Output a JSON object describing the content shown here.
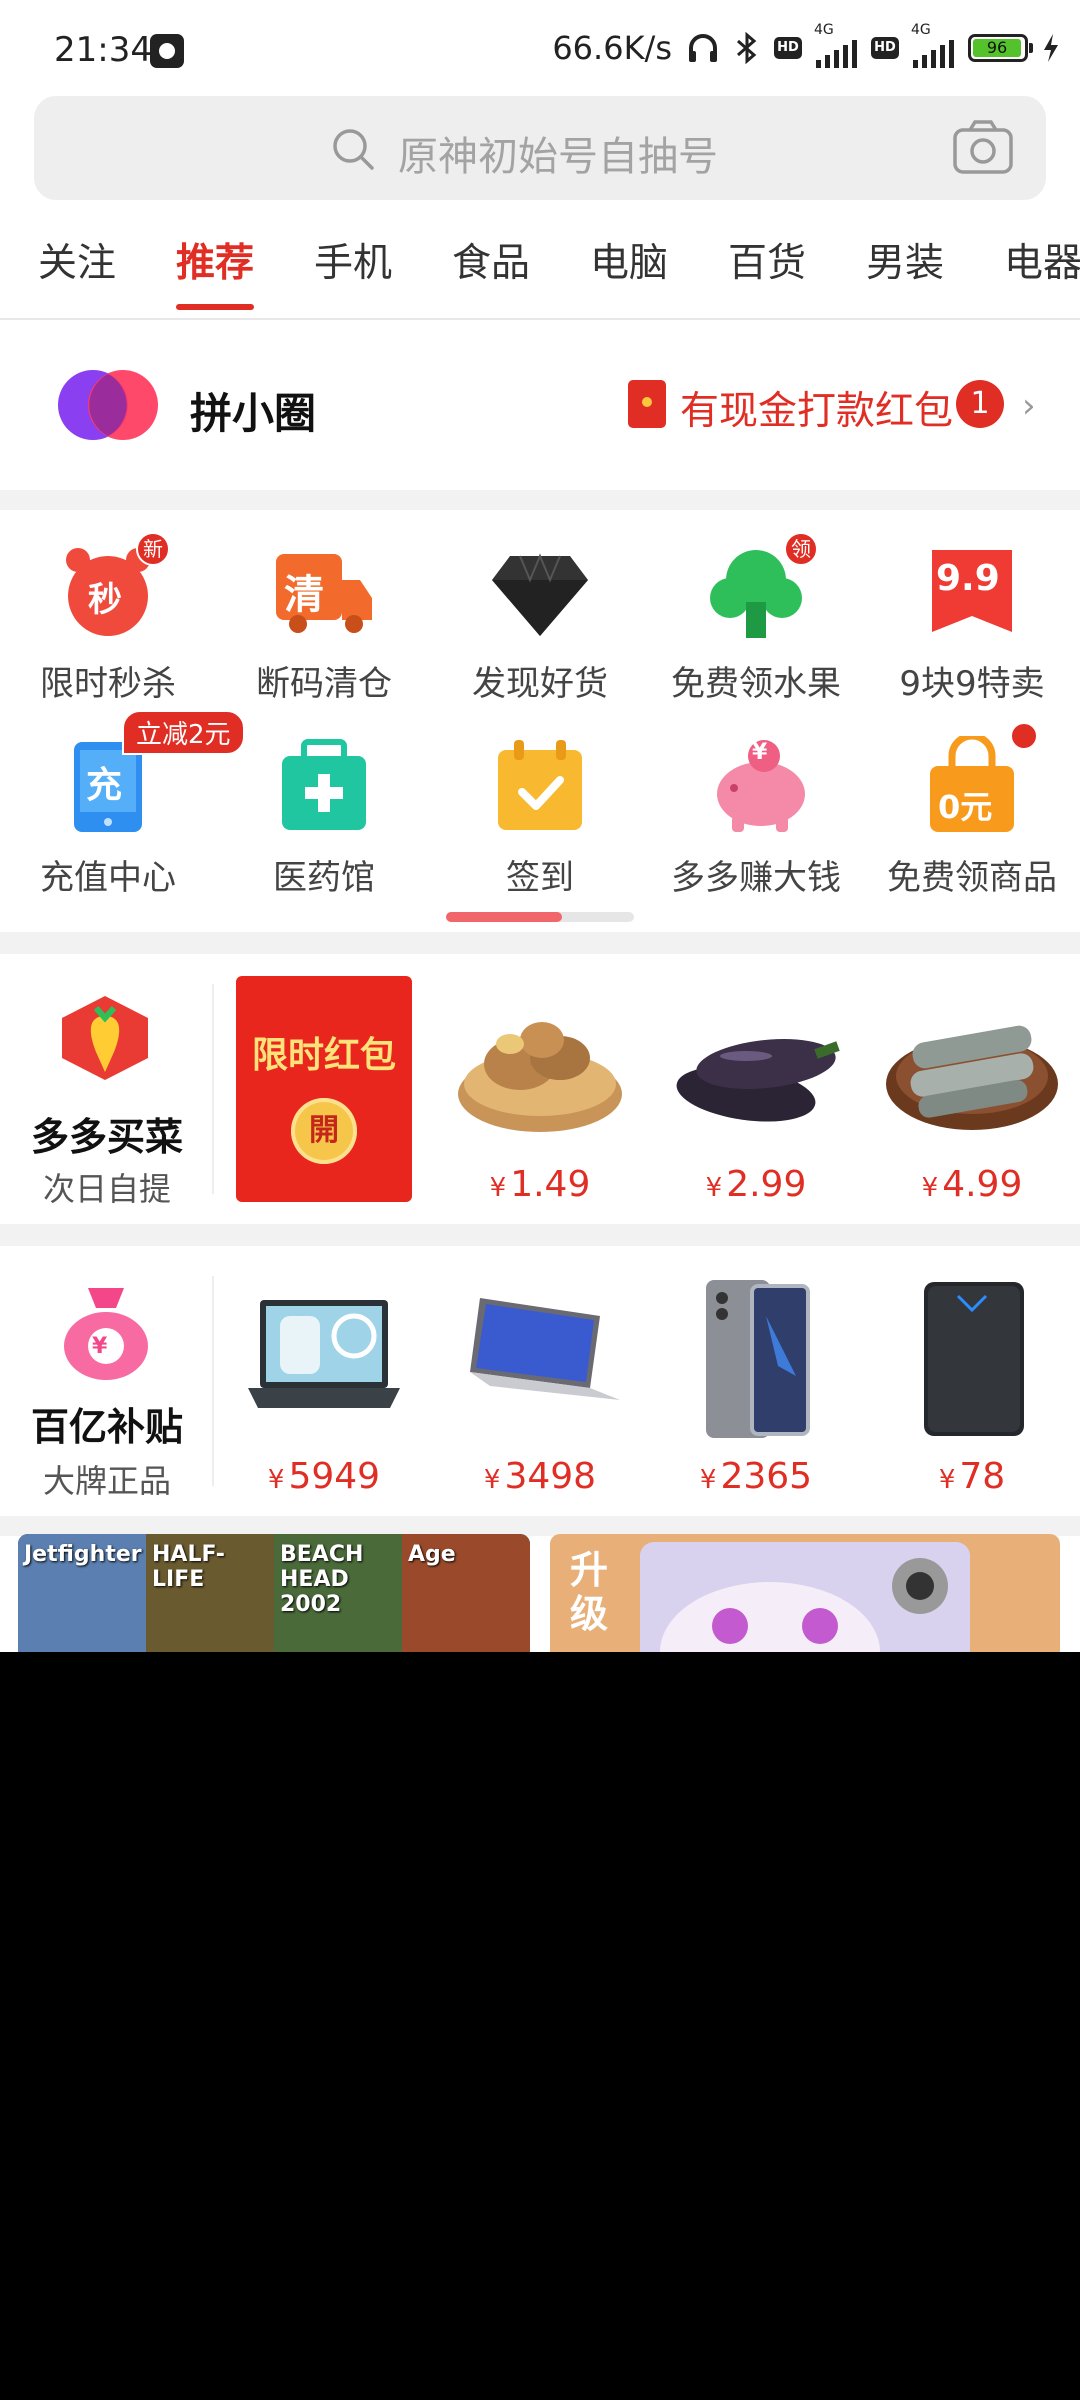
{
  "status_bar": {
    "time": "21:34",
    "speed": "66.6K/s",
    "hd": "HD",
    "net_type": "4G",
    "battery": "96"
  },
  "search": {
    "placeholder": "原神初始号自抽号"
  },
  "tabs": [
    "关注",
    "推荐",
    "手机",
    "食品",
    "电脑",
    "百货",
    "男装",
    "电器"
  ],
  "active_tab": "推荐",
  "pin_circle": {
    "title": "拼小圈",
    "cash_text": "有现金打款红包",
    "count": "1"
  },
  "shortcuts": [
    {
      "label": "限时秒杀",
      "icon": "alarm-clock-icon",
      "glyph": "秒",
      "tag": "新"
    },
    {
      "label": "断码清仓",
      "icon": "truck-icon",
      "glyph": "清"
    },
    {
      "label": "发现好货",
      "icon": "diamond-icon"
    },
    {
      "label": "免费领水果",
      "icon": "tree-icon",
      "tag": "领"
    },
    {
      "label": "9块9特卖",
      "icon": "ribbon-icon",
      "glyph": "9.9"
    },
    {
      "label": "充值中心",
      "icon": "phone-icon",
      "glyph": "充",
      "pill": "立减2元"
    },
    {
      "label": "医药馆",
      "icon": "medical-kit-icon"
    },
    {
      "label": "签到",
      "icon": "calendar-check-icon"
    },
    {
      "label": "多多赚大钱",
      "icon": "piggy-bank-icon",
      "glyph": "¥"
    },
    {
      "label": "免费领商品",
      "icon": "shopping-bag-icon",
      "glyph": "0元"
    }
  ],
  "grocery": {
    "title": "多多买菜",
    "subtitle": "次日自提",
    "promo_title": "限时红包",
    "promo_button": "開",
    "currency": "¥",
    "items": [
      {
        "name": "ginger",
        "price": "1.49"
      },
      {
        "name": "eggplant",
        "price": "2.99"
      },
      {
        "name": "fish",
        "price": "4.99"
      }
    ]
  },
  "subsidy": {
    "title": "百亿补贴",
    "subtitle": "大牌正品",
    "currency": "¥",
    "items": [
      {
        "name": "gaming-laptop",
        "price": "5949"
      },
      {
        "name": "laptop",
        "price": "3498"
      },
      {
        "name": "phone",
        "price": "2365"
      },
      {
        "name": "hard-drive",
        "price": "78"
      }
    ]
  },
  "banners": {
    "games": [
      "Jetfighter",
      "HALF-LIFE",
      "BEACH HEAD 2002",
      "Age"
    ],
    "upgrade_text": "升级"
  }
}
